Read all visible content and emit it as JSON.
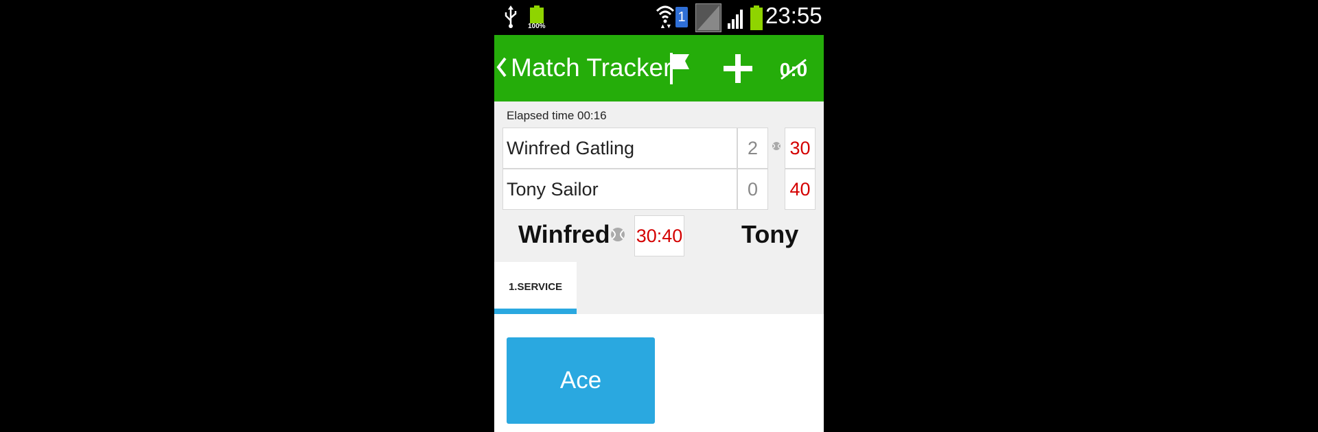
{
  "status_bar": {
    "battery_small_label": "100%",
    "sim_number": "1",
    "time": "23:55",
    "icons": [
      "usb-icon",
      "battery-icon",
      "wifi-icon",
      "sim-icon",
      "no-signal-icon",
      "signal-icon",
      "battery-icon"
    ]
  },
  "action_bar": {
    "title": "Match Tracker",
    "icons": [
      "chevron-left-icon",
      "flag-icon",
      "plus-icon",
      "reset-score-icon"
    ],
    "reset_label": "0:0",
    "color": "#25ad0a"
  },
  "match": {
    "elapsed": "Elapsed time 00:16",
    "players": [
      {
        "name": "Winfred Gatling",
        "sets": "2",
        "points": "30"
      },
      {
        "name": "Tony Sailor",
        "sets": "0",
        "points": "40"
      }
    ],
    "server_short": "Winfred",
    "receiver_short": "Tony",
    "current_score": "30:40"
  },
  "tabs": [
    {
      "label": "1.SERVICE",
      "selected": true
    }
  ],
  "actions": {
    "ace_label": "Ace"
  },
  "colors": {
    "accent": "#2aa8e0",
    "score_red": "#d40000"
  }
}
